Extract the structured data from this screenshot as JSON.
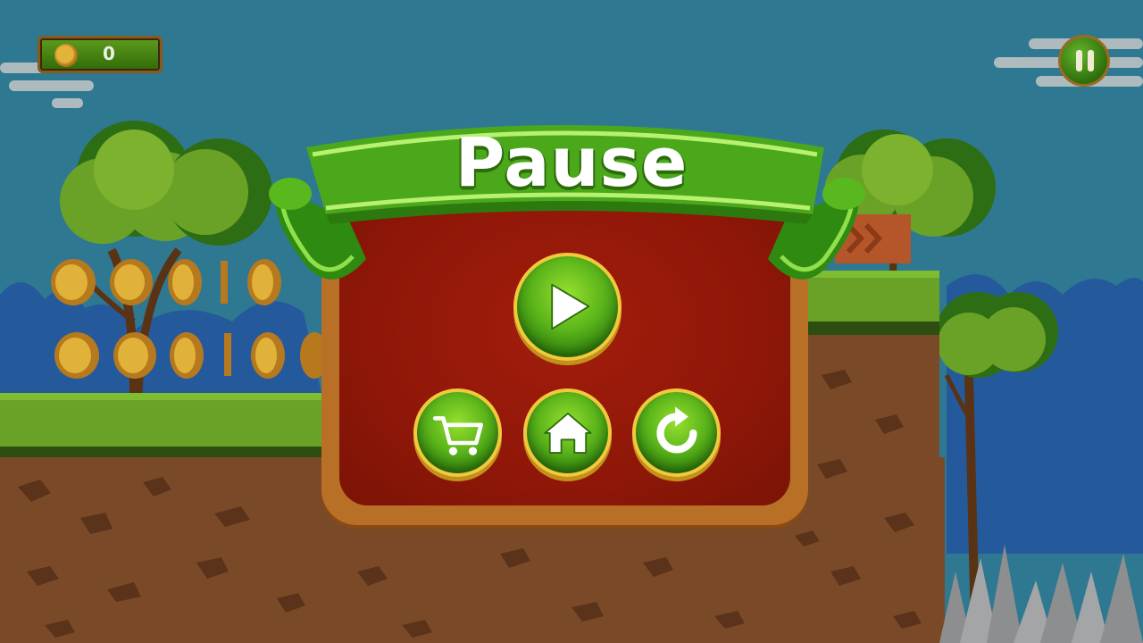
{
  "hud": {
    "coin_count": "0",
    "pause_button_icon": "pause-icon"
  },
  "pause_menu": {
    "title": "Pause",
    "buttons": [
      {
        "name": "resume-button",
        "icon": "play-icon"
      },
      {
        "name": "shop-button",
        "icon": "shopping-cart-icon"
      },
      {
        "name": "home-button",
        "icon": "home-icon"
      },
      {
        "name": "restart-button",
        "icon": "restart-icon"
      }
    ]
  },
  "colors": {
    "sky": "#2f7891",
    "ribbon_green": "#4aa81a",
    "board_red": "#8f1708",
    "board_frame": "#b86f26",
    "button_green": "#5bb41a",
    "button_rim": "#f2c93c"
  }
}
